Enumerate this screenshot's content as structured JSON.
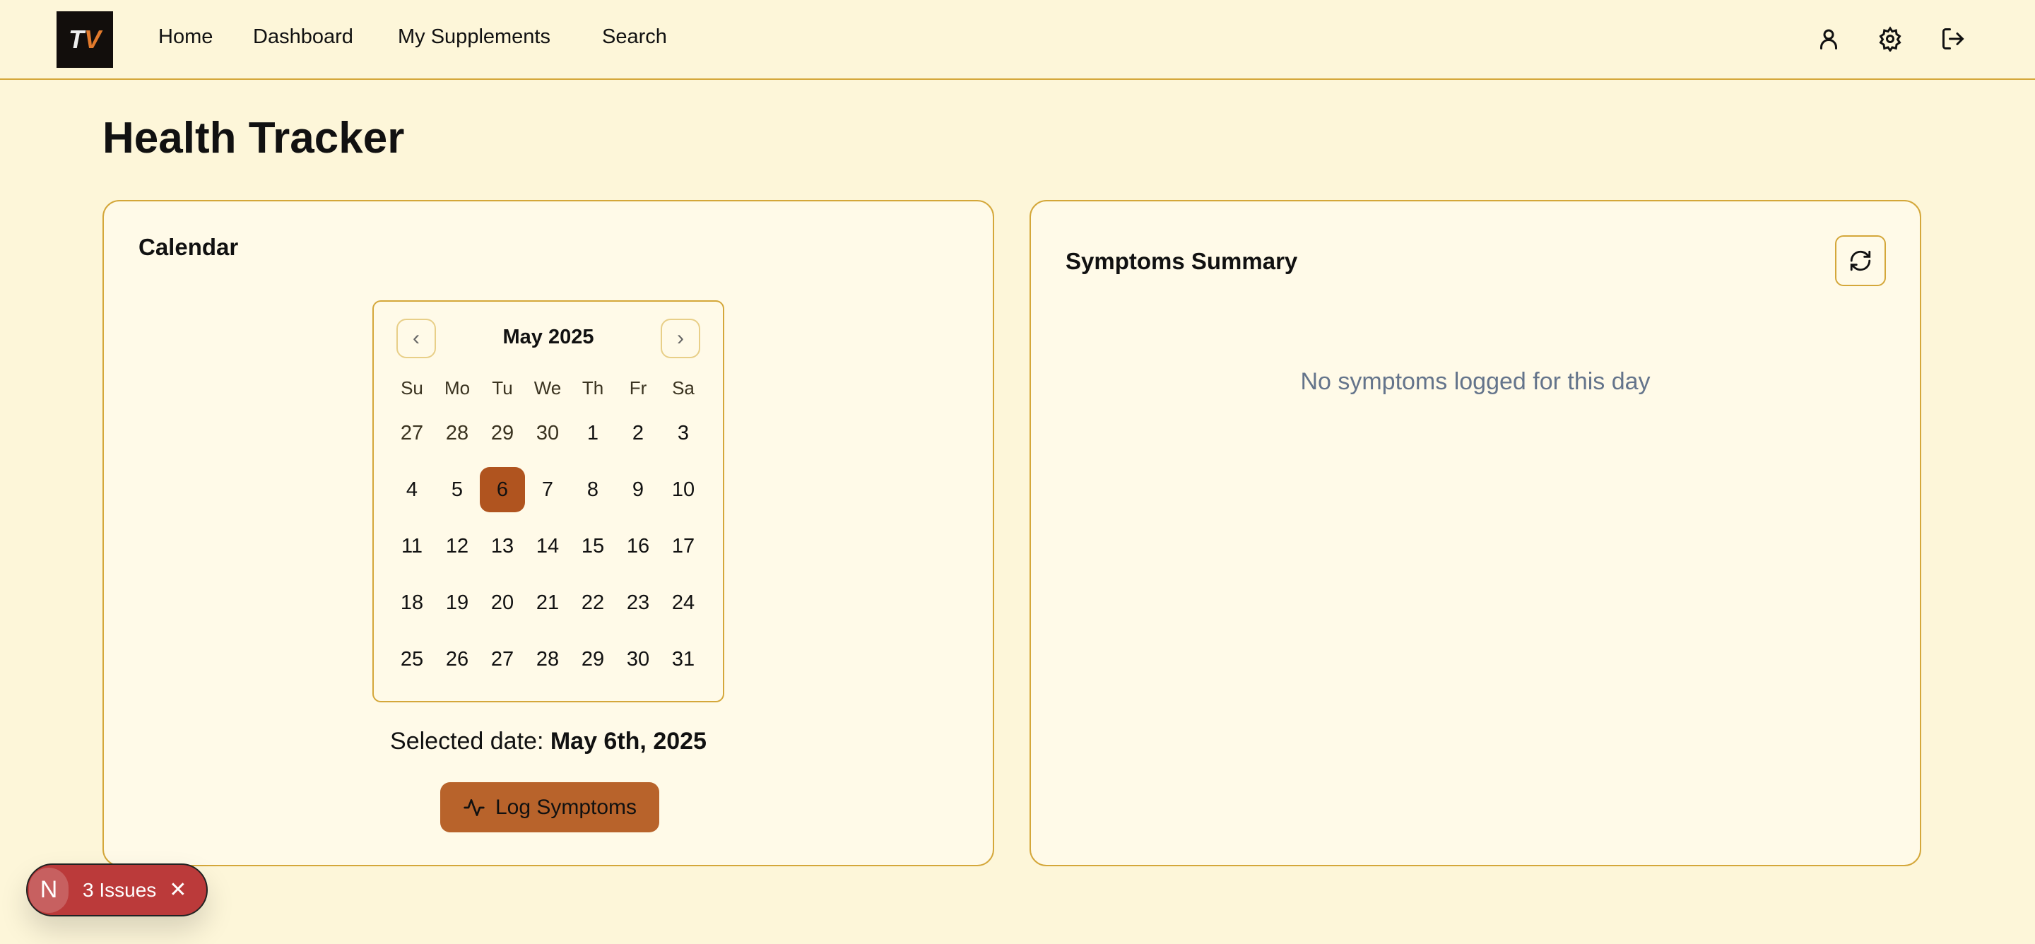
{
  "nav": {
    "logo_text": "TV",
    "links": [
      "Home",
      "Dashboard",
      "My Supplements",
      "Search"
    ],
    "icons": [
      "user-icon",
      "settings-icon",
      "logout-icon"
    ]
  },
  "page_title": "Health Tracker",
  "calendar_card": {
    "title": "Calendar",
    "month_label": "May 2025",
    "weekdays": [
      "Su",
      "Mo",
      "Tu",
      "We",
      "Th",
      "Fr",
      "Sa"
    ],
    "days": [
      "27",
      "28",
      "29",
      "30",
      "1",
      "2",
      "3",
      "4",
      "5",
      "6",
      "7",
      "8",
      "9",
      "10",
      "11",
      "12",
      "13",
      "14",
      "15",
      "16",
      "17",
      "18",
      "19",
      "20",
      "21",
      "22",
      "23",
      "24",
      "25",
      "26",
      "27",
      "28",
      "29",
      "30",
      "31"
    ],
    "selected_day": "6",
    "selected_label": "Selected date: ",
    "selected_value": "May 6th, 2025",
    "log_button": "Log Symptoms"
  },
  "summary_card": {
    "title": "Symptoms Summary",
    "empty_text": "No symptoms logged for this day"
  },
  "issues_badge": {
    "logo": "N",
    "label": "3 Issues"
  },
  "colors": {
    "accent": "#b0541f",
    "button": "#b8632b",
    "border": "#d4a73a",
    "background": "#fdf6d9"
  }
}
